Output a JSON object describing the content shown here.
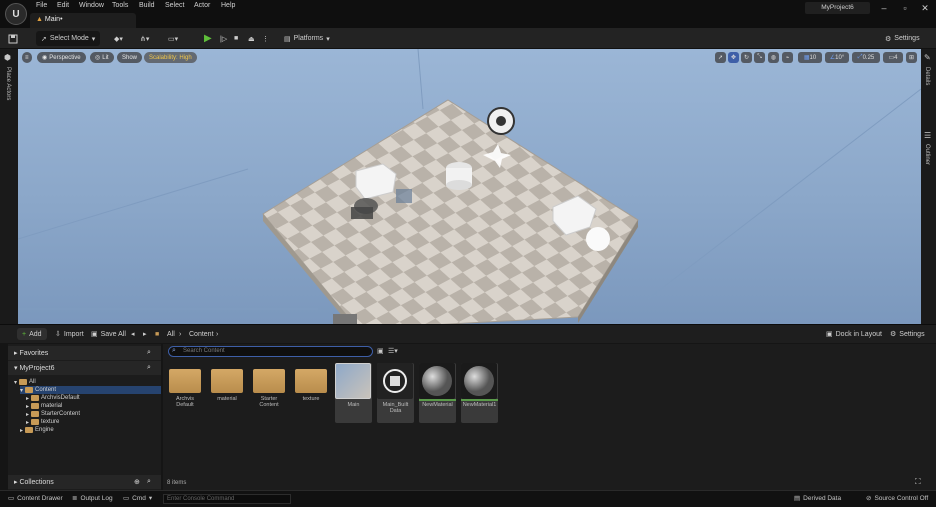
{
  "menu": [
    "File",
    "Edit",
    "Window",
    "Tools",
    "Build",
    "Select",
    "Actor",
    "Help"
  ],
  "tab_title": "Main•",
  "project_name": "MyProject6",
  "toolbar": {
    "select_mode": "Select Mode",
    "platforms": "Platforms",
    "settings": "Settings"
  },
  "left_strip_label": "Place Actors",
  "right_strip": {
    "details": "Details",
    "outliner": "Outliner"
  },
  "viewport": {
    "perspective": "Perspective",
    "lit": "Lit",
    "show": "Show",
    "scalability": "Scalability: High",
    "grid_snap": "10",
    "rot_snap": "10°",
    "scale_snap": "0.25",
    "cam_speed": "4"
  },
  "content_bar": {
    "add": "Add",
    "import": "Import",
    "save_all": "Save All",
    "crumb_all": "All",
    "crumb_content": "Content",
    "dock": "Dock in Layout",
    "settings": "Settings"
  },
  "sources": {
    "favorites": "Favorites",
    "project": "MyProject6",
    "collections": "Collections",
    "tree": [
      {
        "label": "All",
        "depth": 0
      },
      {
        "label": "Content",
        "depth": 1
      },
      {
        "label": "ArchvisDefault",
        "depth": 2
      },
      {
        "label": "material",
        "depth": 2
      },
      {
        "label": "StarterContent",
        "depth": 2
      },
      {
        "label": "texture",
        "depth": 2
      },
      {
        "label": "Engine",
        "depth": 1
      }
    ]
  },
  "search_placeholder": "Search Content",
  "assets": [
    {
      "label": "Archvis Default",
      "kind": "folder"
    },
    {
      "label": "material",
      "kind": "folder"
    },
    {
      "label": "Starter Content",
      "kind": "folder"
    },
    {
      "label": "texture",
      "kind": "folder"
    },
    {
      "label": "Main",
      "kind": "level"
    },
    {
      "label": "Main_Built Data",
      "kind": "data"
    },
    {
      "label": "NewMaterial",
      "kind": "material"
    },
    {
      "label": "NewMaterial1",
      "kind": "material"
    }
  ],
  "item_count": "8 items",
  "status": {
    "content_drawer": "Content Drawer",
    "output_log": "Output Log",
    "cmd": "Cmd",
    "console_placeholder": "Enter Console Command",
    "derived_data": "Derived Data",
    "source_control": "Source Control Off"
  },
  "colors": {
    "accent_blue": "#3e5fa8",
    "play_green": "#5fbf3a",
    "folder": "#c79a56",
    "scalability": "#f2c84b"
  }
}
